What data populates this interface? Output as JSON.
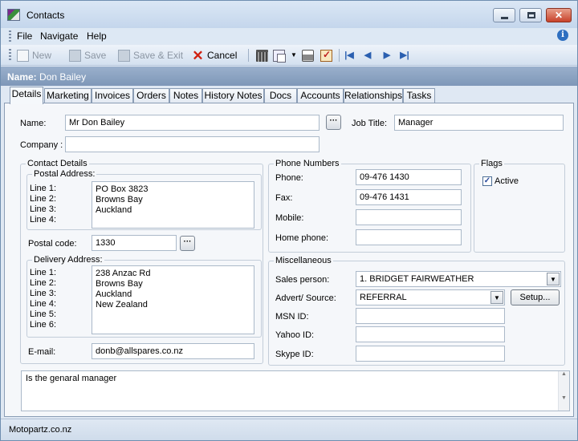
{
  "window": {
    "title": "Contacts"
  },
  "menu": {
    "items": [
      "File",
      "Navigate",
      "Help"
    ]
  },
  "toolbar": {
    "new_label": "New",
    "save_label": "Save",
    "save_exit_label": "Save & Exit",
    "cancel_label": "Cancel"
  },
  "namebar": {
    "text": "Name: Don Bailey",
    "prefix": "Name:",
    "value": "Don Bailey"
  },
  "tabs": [
    "Details",
    "Marketing",
    "Invoices",
    "Orders",
    "Notes",
    "History Notes",
    "Docs",
    "Accounts",
    "Relationships",
    "Tasks"
  ],
  "active_tab": "Details",
  "form": {
    "name_label": "Name:",
    "name_value": "Mr Don Bailey",
    "job_title_label": "Job Title:",
    "job_title_value": "Manager",
    "company_label": "Company :",
    "company_value": "",
    "contact_details_title": "Contact Details",
    "postal_title": "Postal Address:",
    "postal_line_labels": [
      "Line 1:",
      "Line 2:",
      "Line 3:",
      "Line 4:"
    ],
    "postal_lines": [
      "PO Box 3823",
      "Browns Bay",
      "Auckland"
    ],
    "postal_code_label": "Postal code:",
    "postal_code_value": "1330",
    "delivery_title": "Delivery Address:",
    "delivery_line_labels": [
      "Line 1:",
      "Line 2:",
      "Line 3:",
      "Line 4:",
      "Line 5:",
      "Line 6:"
    ],
    "delivery_lines": [
      "238 Anzac Rd",
      "Browns Bay",
      "Auckland",
      "New Zealand"
    ],
    "email_label": "E-mail:",
    "email_value": "donb@allspares.co.nz",
    "phone_title": "Phone Numbers",
    "phone_label": "Phone:",
    "phone_value": "09-476 1430",
    "fax_label": "Fax:",
    "fax_value": "09-476 1431",
    "mobile_label": "Mobile:",
    "mobile_value": "",
    "home_phone_label": "Home phone:",
    "home_phone_value": "",
    "flags_title": "Flags",
    "active_label": "Active",
    "active_checked": true,
    "misc_title": "Miscellaneous",
    "sales_person_label": "Sales person:",
    "sales_person_value": "1. BRIDGET FAIRWEATHER",
    "advert_source_label": "Advert/ Source:",
    "advert_source_value": "REFERRAL",
    "setup_label": "Setup...",
    "msn_label": "MSN ID:",
    "msn_value": "",
    "yahoo_label": "Yahoo ID:",
    "yahoo_value": "",
    "skype_label": "Skype ID:",
    "skype_value": "",
    "notes_value": "Is the genaral manager"
  },
  "status": {
    "text": "Motopartz.co.nz"
  }
}
